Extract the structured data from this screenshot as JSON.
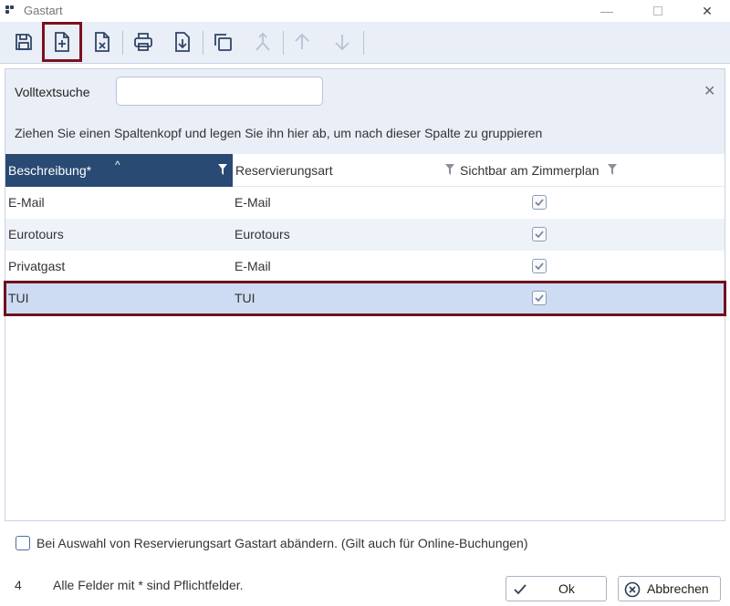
{
  "window": {
    "title": "Gastart",
    "min_glyph": "—",
    "close_glyph": "✕"
  },
  "toolbar": {
    "buttons": [
      {
        "name": "save-icon"
      },
      {
        "name": "new-document-icon",
        "selected": true
      },
      {
        "name": "delete-document-icon"
      },
      {
        "name": "print-icon"
      },
      {
        "name": "export-icon"
      },
      {
        "name": "copy-icon"
      },
      {
        "name": "merge-icon",
        "disabled": true
      },
      {
        "name": "arrow-up-icon",
        "disabled": true
      },
      {
        "name": "arrow-down-icon",
        "disabled": true
      }
    ]
  },
  "search": {
    "label": "Volltextsuche",
    "value": "",
    "placeholder": "",
    "clear_glyph": "✕"
  },
  "group_hint": "Ziehen Sie einen Spaltenkopf und legen Sie ihn hier ab, um nach dieser Spalte zu gruppieren",
  "grid": {
    "columns": [
      {
        "label": "Beschreibung*",
        "sorted": "ascending",
        "active": true
      },
      {
        "label": "Reservierungsart"
      },
      {
        "label": "Sichtbar am Zimmerplan"
      }
    ],
    "rows": [
      {
        "beschreibung": "E-Mail",
        "reservierungsart": "E-Mail",
        "sichtbar": true
      },
      {
        "beschreibung": "Eurotours",
        "reservierungsart": "Eurotours",
        "sichtbar": true
      },
      {
        "beschreibung": "Privatgast",
        "reservierungsart": "E-Mail",
        "sichtbar": true
      },
      {
        "beschreibung": "TUI",
        "reservierungsart": "TUI",
        "sichtbar": true,
        "selected": true
      }
    ]
  },
  "footer": {
    "checkbox_label": "Bei Auswahl von Reservierungsart Gastart abändern. (Gilt auch für Online-Buchungen)",
    "checkbox_checked": false,
    "count": "4",
    "required_hint": "Alle Felder mit * sind Pflichtfelder.",
    "ok_label": "Ok",
    "cancel_label": "Abbrechen"
  },
  "colors": {
    "accent": "#294a73",
    "selection_outline": "#7b1020",
    "toolbar_bg": "#e9eef7",
    "row_alt": "#eef2f9",
    "row_selected": "#cddcf2"
  }
}
